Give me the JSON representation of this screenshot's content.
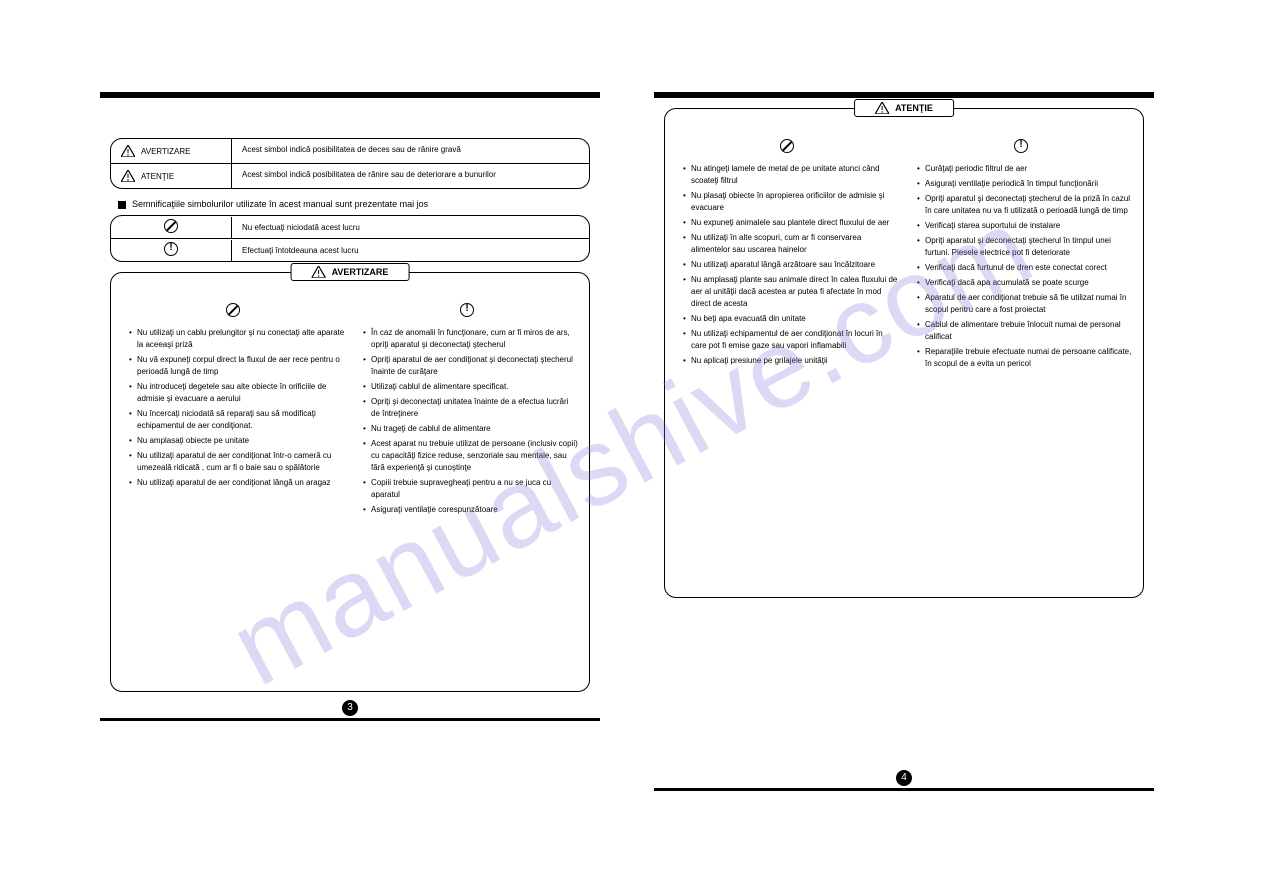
{
  "page3": {
    "tbl1": {
      "r1": {
        "label": "AVERTIZARE",
        "desc": "Acest simbol indică posibilitatea de deces sau de rănire gravă"
      },
      "r2": {
        "label": "ATENŢIE",
        "desc": "Acest simbol indică posibilitatea de rănire sau de deteriorare a bunurilor"
      }
    },
    "sub": "Semnificaţiile simbolurilor utilizate în acest manual sunt prezentate mai jos",
    "tbl2": {
      "r1": "Nu efectuaţi niciodată acest lucru",
      "r2": "Efectuaţi întotdeauna acest lucru"
    },
    "box": {
      "hdr": "AVERTIZARE",
      "left": [
        "Nu utilizaţi un cablu prelungitor şi nu conectaţi alte aparate la aceeaşi priză",
        "Nu vă expuneţi corpul direct la fluxul de aer rece pentru o perioadă lungă de timp",
        "Nu introduceţi degetele sau alte obiecte în orificiile de admisie şi evacuare a aerului",
        "Nu încercaţi niciodată să reparaţi sau să modificaţi echipamentul de aer condiţionat.",
        "Nu amplasaţi obiecte pe unitate",
        "Nu utilizaţi aparatul de aer condiţionat într-o cameră cu umezeală ridicată , cum ar fi o baie sau o spălătorie",
        "Nu utilizaţi aparatul de aer condiţionat lângă un aragaz"
      ],
      "right": [
        "În caz de anomalii în funcţionare, cum ar fi miros de ars, opriţi aparatul şi deconectaţi ştecherul",
        "Opriţi aparatul de aer condiţionat şi deconectaţi ştecherul înainte de curăţare",
        "Utilizaţi cablul de alimentare specificat.",
        "Opriţi şi deconectaţi unitatea înainte de a efectua lucrări de întreţinere",
        "Nu trageţi de cablul de alimentare",
        "Acest aparat nu trebuie utilizat de persoane (inclusiv copii) cu capacităţi fizice reduse, senzoriale sau mentale, sau fără experienţă şi cunoştinţe",
        "Copiii trebuie supravegheaţi pentru a nu se juca cu aparatul",
        "Asiguraţi ventilaţie corespunzătoare"
      ]
    }
  },
  "page4": {
    "box": {
      "hdr": "ATENŢIE",
      "left": [
        "Nu atingeţi lamele de metal de pe unitate atunci când scoateţi filtrul",
        "Nu plasaţi obiecte în apropierea orificiilor de admisie şi evacuare",
        "Nu expuneţi animalele sau plantele direct fluxului de aer",
        "Nu utilizaţi în alte scopuri, cum ar fi conservarea alimentelor sau uscarea hainelor",
        "Nu utilizaţi aparatul lângă arzătoare sau încălzitoare",
        "Nu amplasaţi plante sau animale direct în calea fluxului de aer al unităţii dacă acestea ar putea fi afectate în mod direct de acesta",
        "Nu beţi apa evacuată din unitate",
        "Nu utilizaţi echipamentul de aer condiţionat în locuri în care pot fi emise gaze sau vapori inflamabili",
        "Nu aplicaţi presiune pe grilajele unităţii"
      ],
      "right": [
        "Curăţaţi periodic filtrul de aer",
        "Asiguraţi ventilaţie periodică în timpul funcţionării",
        "Opriţi aparatul şi deconectaţi ştecherul de la priză în cazul în care unitatea nu va fi utilizată o perioadă lungă de timp",
        "Verificaţi starea suportului de instalare",
        "Opriţi aparatul şi deconectaţi ştecherul în timpul unei furtuni. Piesele electrice pot fi deteriorate",
        "Verificaţi dacă furtunul de dren este conectat corect",
        "Verificaţi dacă apa acumulată se poate scurge",
        "Aparatul de aer condiţionat trebuie să fie utilizat numai în scopul pentru care a fost proiectat",
        "Cablul de alimentare trebuie înlocuit numai de personal calificat",
        "Reparaţiile trebuie efectuate numai de persoane calificate, în scopul de a evita un pericol"
      ]
    }
  },
  "pn": {
    "p3": "3",
    "p4": "4"
  }
}
